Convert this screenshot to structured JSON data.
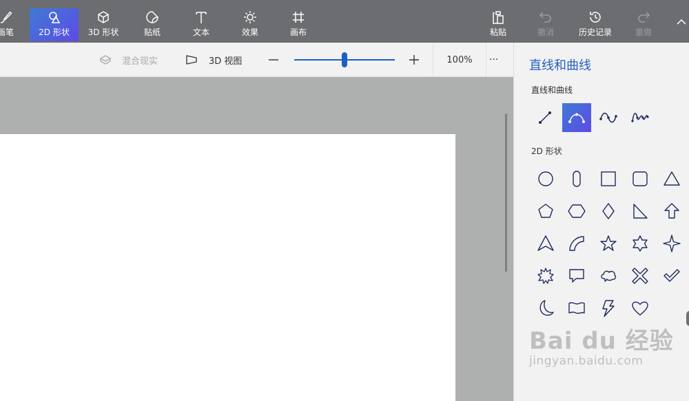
{
  "toolbar": {
    "tools": [
      {
        "label": "画笔",
        "icon": "brush-icon"
      },
      {
        "label": "2D 形状",
        "icon": "2d-shapes-icon",
        "active": true
      },
      {
        "label": "3D 形状",
        "icon": "3d-cube-icon"
      },
      {
        "label": "贴纸",
        "icon": "sticker-icon"
      },
      {
        "label": "文本",
        "icon": "text-icon"
      },
      {
        "label": "效果",
        "icon": "effects-sun-icon"
      },
      {
        "label": "画布",
        "icon": "canvas-crop-icon"
      }
    ],
    "paste_label": "粘贴",
    "undo_label": "撤消",
    "history_label": "历史记录",
    "redo_label": "重做"
  },
  "subbar": {
    "mixed_reality_label": "混合现实",
    "view3d_label": "3D 视图",
    "zoom_value": 50,
    "zoom_percent": "100%",
    "more_label": "···"
  },
  "panel": {
    "title": "直线和曲线",
    "lines_section": "直线和曲线",
    "shapes_section": "2D 形状",
    "line_tools": [
      "line-icon",
      "curve-icon",
      "two-point-curve-icon",
      "three-point-curve-icon"
    ],
    "selected_line_tool": "curve-icon",
    "shapes": [
      "circle-icon",
      "capsule-icon",
      "square-icon",
      "rounded-square-icon",
      "triangle-icon",
      "pentagon-icon",
      "hexagon-icon",
      "diamond-icon",
      "right-triangle-icon",
      "arrow-up-icon",
      "arrowhead-icon",
      "quarter-circle-icon",
      "star-5-icon",
      "star-6-icon",
      "star-4-icon",
      "burst-icon",
      "speech-bubble-icon",
      "thought-bubble-icon",
      "x-mark-icon",
      "check-mark-icon",
      "crescent-moon-icon",
      "banner-icon",
      "lightning-icon",
      "heart-icon"
    ]
  },
  "colors": {
    "toolbar_bg": "#6c6d70",
    "accent_start": "#3f7ad4",
    "accent_end": "#5d4be6",
    "panel_title": "#2460c4",
    "slider": "#1c5fc4",
    "icon_stroke": "#1d2a5c"
  },
  "watermark": {
    "main": "Bai du 经验",
    "sub": "jingyan.baidu.com"
  }
}
